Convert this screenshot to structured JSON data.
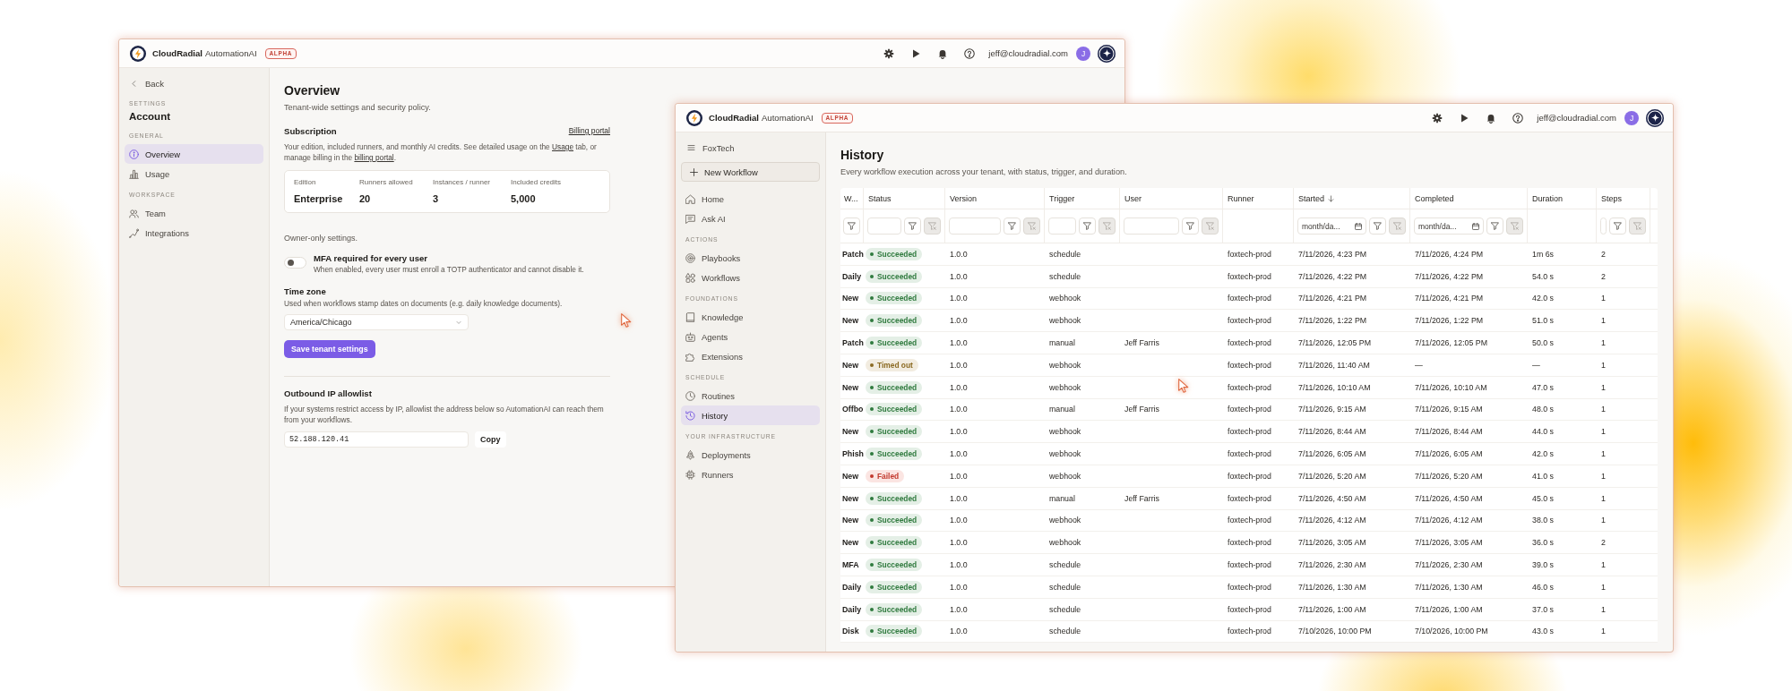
{
  "settings_window": {
    "header": {
      "brand": "CloudRadial",
      "product": "AutomationAI",
      "badge": "ALPHA",
      "email": "jeff@cloudradial.com",
      "avatar": "J"
    },
    "sidebar": {
      "back": "Back",
      "eyebrow": "SETTINGS",
      "title": "Account",
      "sections": [
        {
          "label": "GENERAL",
          "items": [
            {
              "label": "Overview",
              "selected": true
            },
            {
              "label": "Usage",
              "selected": false
            }
          ]
        },
        {
          "label": "WORKSPACE",
          "items": [
            {
              "label": "Team",
              "selected": false
            },
            {
              "label": "Integrations",
              "selected": false
            }
          ]
        }
      ]
    },
    "page": {
      "title": "Overview",
      "subtitle": "Tenant-wide settings and security policy.",
      "subscription": {
        "heading": "Subscription",
        "link": "Billing portal",
        "description": [
          {
            "kind": "text",
            "text": "Your edition, included runners, and monthly AI credits. See detailed usage on the "
          },
          {
            "kind": "link",
            "text": "Usage"
          },
          {
            "kind": "text",
            "text": " tab, or manage billing in the "
          },
          {
            "kind": "link",
            "text": "billing portal"
          },
          {
            "kind": "text",
            "text": "."
          }
        ],
        "stats": [
          {
            "label": "Edition",
            "value": "Enterprise"
          },
          {
            "label": "Runners allowed",
            "value": "20"
          },
          {
            "label": "Instances / runner",
            "value": "3"
          },
          {
            "label": "Included credits",
            "value": "5,000"
          }
        ]
      },
      "owner_note": "Owner-only settings.",
      "mfa": {
        "title": "MFA required for every user",
        "description": "When enabled, every user must enroll a TOTP authenticator and cannot disable it.",
        "on": false
      },
      "time_zone": {
        "label": "Time zone",
        "description": "Used when workflows stamp dates on documents (e.g. daily knowledge documents).",
        "value": "America/Chicago"
      },
      "save_button": "Save tenant settings",
      "allowlist": {
        "heading": "Outbound IP allowlist",
        "description": "If your systems restrict access by IP, allowlist the address below so AutomationAI can reach them from your workflows.",
        "value": "52.188.120.41",
        "button": "Copy"
      }
    }
  },
  "history_window": {
    "header": {
      "brand": "CloudRadial",
      "product": "AutomationAI",
      "badge": "ALPHA",
      "email": "jeff@cloudradial.com",
      "avatar": "J"
    },
    "sidebar": {
      "workspace": "FoxTech",
      "new_button": "New Workflow",
      "groups": [
        {
          "items": [
            {
              "label": "Home",
              "selected": false
            },
            {
              "label": "Ask AI",
              "selected": false
            }
          ]
        },
        {
          "label": "ACTIONS",
          "items": [
            {
              "label": "Playbooks",
              "selected": false
            },
            {
              "label": "Workflows",
              "selected": false
            }
          ]
        },
        {
          "label": "FOUNDATIONS",
          "items": [
            {
              "label": "Knowledge",
              "selected": false
            },
            {
              "label": "Agents",
              "selected": false
            },
            {
              "label": "Extensions",
              "selected": false
            }
          ]
        },
        {
          "label": "SCHEDULE",
          "items": [
            {
              "label": "Routines",
              "selected": false
            },
            {
              "label": "History",
              "selected": true
            }
          ]
        },
        {
          "label": "YOUR INFRASTRUCTURE",
          "items": [
            {
              "label": "Deployments",
              "selected": false
            },
            {
              "label": "Runners",
              "selected": false
            }
          ]
        }
      ]
    },
    "page": {
      "title": "History",
      "subtitle": "Every workflow execution across your tenant, with status, trigger, and duration.",
      "table": {
        "columns": [
          {
            "label": "W...",
            "sorted": false,
            "filter": {
              "kind": "button"
            }
          },
          {
            "label": "Status",
            "sorted": false,
            "filter": {
              "kind": "text",
              "clear_disabled": true
            }
          },
          {
            "label": "Version",
            "sorted": false,
            "filter": {
              "kind": "text",
              "clear_disabled": true
            }
          },
          {
            "label": "Trigger",
            "sorted": false,
            "filter": {
              "kind": "text",
              "clear_disabled": true
            }
          },
          {
            "label": "User",
            "sorted": false,
            "filter": {
              "kind": "text",
              "clear_disabled": true
            }
          },
          {
            "label": "Runner",
            "sorted": false
          },
          {
            "label": "Started",
            "sorted": true,
            "filter": {
              "kind": "date",
              "placeholder": "month/da...",
              "clear_disabled": true
            }
          },
          {
            "label": "Completed",
            "sorted": false,
            "filter": {
              "kind": "date",
              "placeholder": "month/da...",
              "clear_disabled": true
            }
          },
          {
            "label": "Duration",
            "sorted": false
          },
          {
            "label": "Steps",
            "sorted": false,
            "filter": {
              "kind": "text",
              "clear_disabled": true
            }
          }
        ],
        "rows": [
          {
            "workflow": "Patch",
            "status": {
              "label": "Succeeded",
              "kind": "succeeded"
            },
            "version": "1.0.0",
            "trigger": "schedule",
            "runner": "foxtech-prod",
            "started": "7/11/2026, 4:23 PM",
            "completed": "7/11/2026, 4:24 PM",
            "duration": "1m 6s",
            "steps": "2"
          },
          {
            "workflow": "Daily",
            "status": {
              "label": "Succeeded",
              "kind": "succeeded"
            },
            "version": "1.0.0",
            "trigger": "schedule",
            "runner": "foxtech-prod",
            "started": "7/11/2026, 4:22 PM",
            "completed": "7/11/2026, 4:22 PM",
            "duration": "54.0 s",
            "steps": "2"
          },
          {
            "workflow": "New",
            "status": {
              "label": "Succeeded",
              "kind": "succeeded"
            },
            "version": "1.0.0",
            "trigger": "webhook",
            "runner": "foxtech-prod",
            "started": "7/11/2026, 4:21 PM",
            "completed": "7/11/2026, 4:21 PM",
            "duration": "42.0 s",
            "steps": "1"
          },
          {
            "workflow": "New",
            "status": {
              "label": "Succeeded",
              "kind": "succeeded"
            },
            "version": "1.0.0",
            "trigger": "webhook",
            "runner": "foxtech-prod",
            "started": "7/11/2026, 1:22 PM",
            "completed": "7/11/2026, 1:22 PM",
            "duration": "51.0 s",
            "steps": "1"
          },
          {
            "workflow": "Patch",
            "status": {
              "label": "Succeeded",
              "kind": "succeeded"
            },
            "version": "1.0.0",
            "trigger": "manual",
            "user": "Jeff Farris",
            "runner": "foxtech-prod",
            "started": "7/11/2026, 12:05 PM",
            "completed": "7/11/2026, 12:05 PM",
            "duration": "50.0 s",
            "steps": "1"
          },
          {
            "workflow": "New",
            "status": {
              "label": "Timed out",
              "kind": "timed_out"
            },
            "version": "1.0.0",
            "trigger": "webhook",
            "runner": "foxtech-prod",
            "started": "7/11/2026, 11:40 AM",
            "completed": "—",
            "duration": "—",
            "steps": "1"
          },
          {
            "workflow": "New",
            "status": {
              "label": "Succeeded",
              "kind": "succeeded"
            },
            "version": "1.0.0",
            "trigger": "webhook",
            "runner": "foxtech-prod",
            "started": "7/11/2026, 10:10 AM",
            "completed": "7/11/2026, 10:10 AM",
            "duration": "47.0 s",
            "steps": "1"
          },
          {
            "workflow": "Offbo",
            "status": {
              "label": "Succeeded",
              "kind": "succeeded"
            },
            "version": "1.0.0",
            "trigger": "manual",
            "user": "Jeff Farris",
            "runner": "foxtech-prod",
            "started": "7/11/2026, 9:15 AM",
            "completed": "7/11/2026, 9:15 AM",
            "duration": "48.0 s",
            "steps": "1"
          },
          {
            "workflow": "New",
            "status": {
              "label": "Succeeded",
              "kind": "succeeded"
            },
            "version": "1.0.0",
            "trigger": "webhook",
            "runner": "foxtech-prod",
            "started": "7/11/2026, 8:44 AM",
            "completed": "7/11/2026, 8:44 AM",
            "duration": "44.0 s",
            "steps": "1"
          },
          {
            "workflow": "Phish",
            "status": {
              "label": "Succeeded",
              "kind": "succeeded"
            },
            "version": "1.0.0",
            "trigger": "webhook",
            "runner": "foxtech-prod",
            "started": "7/11/2026, 6:05 AM",
            "completed": "7/11/2026, 6:05 AM",
            "duration": "42.0 s",
            "steps": "1"
          },
          {
            "workflow": "New",
            "status": {
              "label": "Failed",
              "kind": "failed"
            },
            "version": "1.0.0",
            "trigger": "webhook",
            "runner": "foxtech-prod",
            "started": "7/11/2026, 5:20 AM",
            "completed": "7/11/2026, 5:20 AM",
            "duration": "41.0 s",
            "steps": "1"
          },
          {
            "workflow": "New",
            "status": {
              "label": "Succeeded",
              "kind": "succeeded"
            },
            "version": "1.0.0",
            "trigger": "manual",
            "user": "Jeff Farris",
            "runner": "foxtech-prod",
            "started": "7/11/2026, 4:50 AM",
            "completed": "7/11/2026, 4:50 AM",
            "duration": "45.0 s",
            "steps": "1"
          },
          {
            "workflow": "New",
            "status": {
              "label": "Succeeded",
              "kind": "succeeded"
            },
            "version": "1.0.0",
            "trigger": "webhook",
            "runner": "foxtech-prod",
            "started": "7/11/2026, 4:12 AM",
            "completed": "7/11/2026, 4:12 AM",
            "duration": "38.0 s",
            "steps": "1"
          },
          {
            "workflow": "New",
            "status": {
              "label": "Succeeded",
              "kind": "succeeded"
            },
            "version": "1.0.0",
            "trigger": "webhook",
            "runner": "foxtech-prod",
            "started": "7/11/2026, 3:05 AM",
            "completed": "7/11/2026, 3:05 AM",
            "duration": "36.0 s",
            "steps": "2"
          },
          {
            "workflow": "MFA",
            "status": {
              "label": "Succeeded",
              "kind": "succeeded"
            },
            "version": "1.0.0",
            "trigger": "schedule",
            "runner": "foxtech-prod",
            "started": "7/11/2026, 2:30 AM",
            "completed": "7/11/2026, 2:30 AM",
            "duration": "39.0 s",
            "steps": "1"
          },
          {
            "workflow": "Daily",
            "status": {
              "label": "Succeeded",
              "kind": "succeeded"
            },
            "version": "1.0.0",
            "trigger": "schedule",
            "runner": "foxtech-prod",
            "started": "7/11/2026, 1:30 AM",
            "completed": "7/11/2026, 1:30 AM",
            "duration": "46.0 s",
            "steps": "1"
          },
          {
            "workflow": "Daily",
            "status": {
              "label": "Succeeded",
              "kind": "succeeded"
            },
            "version": "1.0.0",
            "trigger": "schedule",
            "runner": "foxtech-prod",
            "started": "7/11/2026, 1:00 AM",
            "completed": "7/11/2026, 1:00 AM",
            "duration": "37.0 s",
            "steps": "1"
          },
          {
            "workflow": "Disk",
            "status": {
              "label": "Succeeded",
              "kind": "succeeded"
            },
            "version": "1.0.0",
            "trigger": "schedule",
            "runner": "foxtech-prod",
            "started": "7/10/2026, 10:00 PM",
            "completed": "7/10/2026, 10:00 PM",
            "duration": "43.0 s",
            "steps": "1"
          }
        ]
      }
    }
  }
}
